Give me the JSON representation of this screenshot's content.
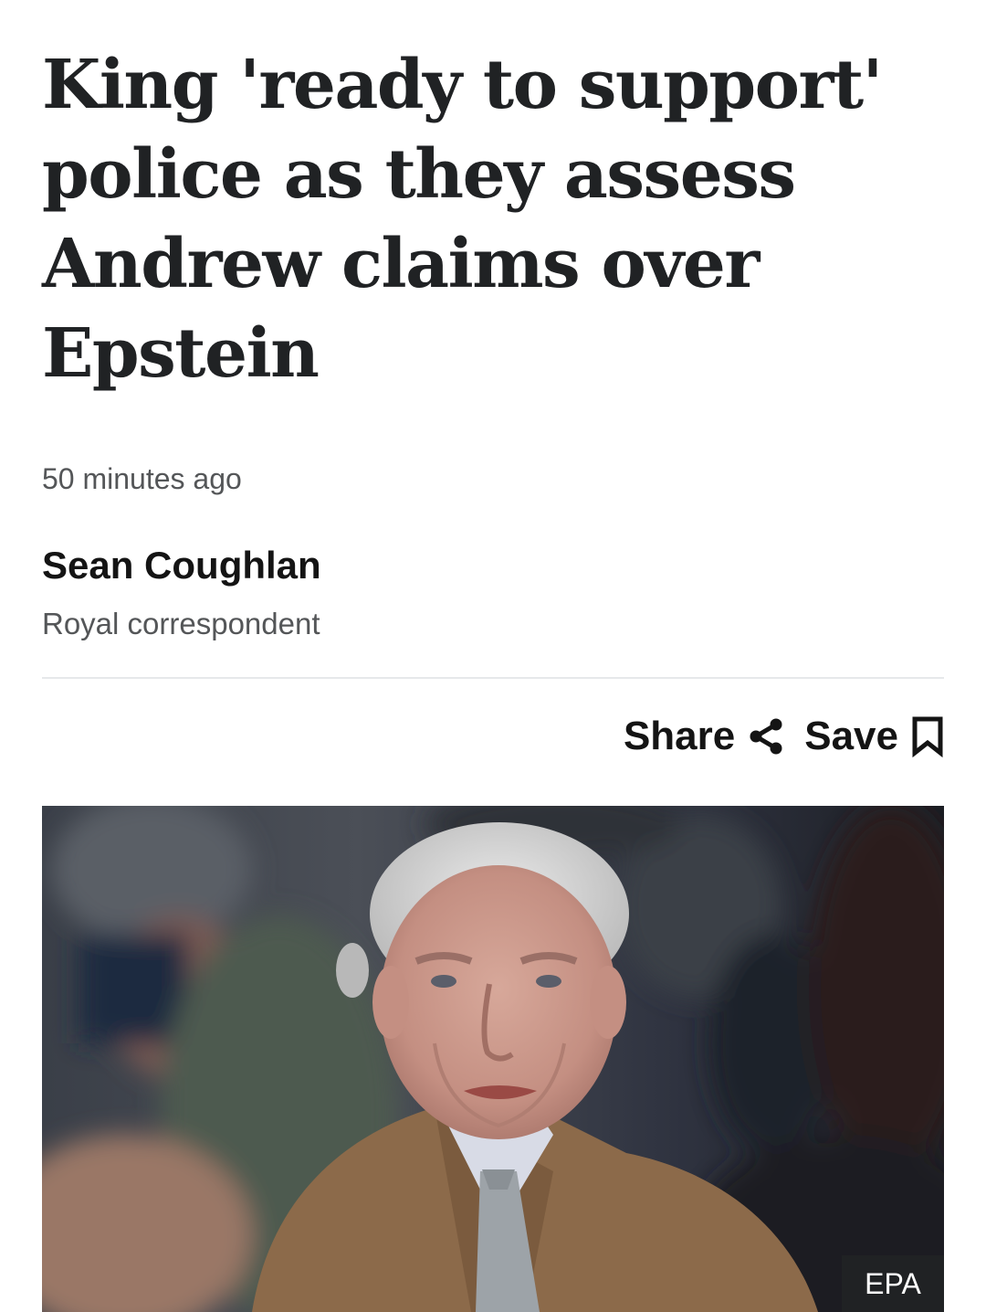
{
  "article": {
    "headline": "King 'ready to support' police as they assess Andrew claims over Epstein",
    "timestamp": "50 minutes ago",
    "author": {
      "name": "Sean Coughlan",
      "role": "Royal correspondent"
    }
  },
  "actions": {
    "share_label": "Share",
    "share_icon": "share-icon",
    "save_label": "Save",
    "save_icon": "bookmark-icon"
  },
  "image": {
    "credit": "EPA"
  }
}
